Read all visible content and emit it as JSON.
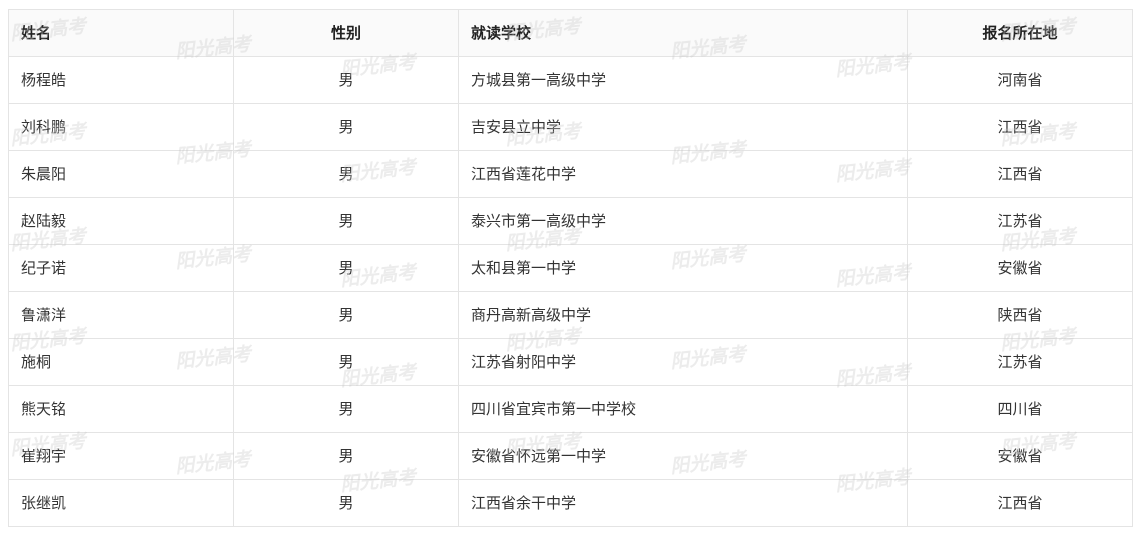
{
  "table": {
    "headers": [
      "姓名",
      "性别",
      "就读学校",
      "报名所在地"
    ],
    "rows": [
      {
        "name": "杨程皓",
        "gender": "男",
        "school": "方城县第一高级中学",
        "location": "河南省"
      },
      {
        "name": "刘科鹏",
        "gender": "男",
        "school": "吉安县立中学",
        "location": "江西省"
      },
      {
        "name": "朱晨阳",
        "gender": "男",
        "school": "江西省莲花中学",
        "location": "江西省"
      },
      {
        "name": "赵陆毅",
        "gender": "男",
        "school": "泰兴市第一高级中学",
        "location": "江苏省"
      },
      {
        "name": "纪子诺",
        "gender": "男",
        "school": "太和县第一中学",
        "location": "安徽省"
      },
      {
        "name": "鲁潇洋",
        "gender": "男",
        "school": "商丹高新高级中学",
        "location": "陕西省"
      },
      {
        "name": "施桐",
        "gender": "男",
        "school": "江苏省射阳中学",
        "location": "江苏省"
      },
      {
        "name": "熊天铭",
        "gender": "男",
        "school": "四川省宜宾市第一中学校",
        "location": "四川省"
      },
      {
        "name": "崔翔宇",
        "gender": "男",
        "school": "安徽省怀远第一中学",
        "location": "安徽省"
      },
      {
        "name": "张继凯",
        "gender": "男",
        "school": "江西省余干中学",
        "location": "江西省"
      }
    ]
  },
  "watermark": {
    "text": "阳光高考"
  },
  "colors": {
    "border": "#e4e4e4",
    "text": "#333333",
    "header_text": "#222222"
  }
}
